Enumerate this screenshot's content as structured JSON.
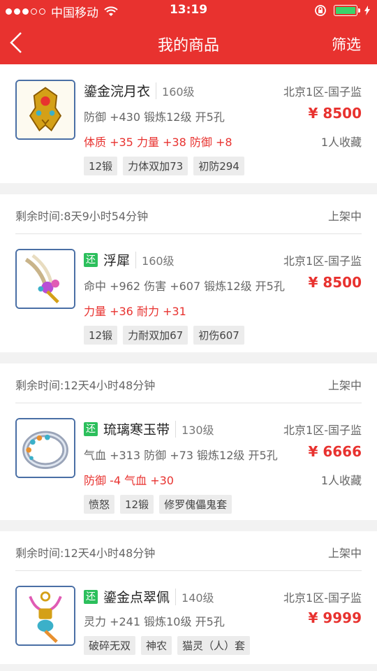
{
  "status_bar": {
    "carrier": "中国移动",
    "time": "13:19"
  },
  "nav": {
    "title": "我的商品",
    "filter_label": "筛选"
  },
  "items": [
    {
      "time_left": "",
      "status": "",
      "name": "鎏金浣月衣",
      "level": "160级",
      "server": "北京1区-国子监",
      "attrs": "防御 +430 锻炼12级 开5孔",
      "bonus": "体质 +35 力量 +38 防御 +8",
      "price": "¥ 8500",
      "favorites": "1人收藏",
      "tags": [
        "12锻",
        "力体双加73",
        "初防294"
      ],
      "returnable": false
    },
    {
      "time_left": "剩余时间:8天9小时54分钟",
      "status": "上架中",
      "name": "浮犀",
      "level": "160级",
      "server": "北京1区-国子监",
      "attrs": "命中 +962 伤害 +607 锻炼12级 开5孔",
      "bonus": "力量 +36 耐力 +31",
      "price": "¥ 8500",
      "favorites": "",
      "tags": [
        "12锻",
        "力耐双加67",
        "初伤607"
      ],
      "returnable": true,
      "return_label": "还"
    },
    {
      "time_left": "剩余时间:12天4小时48分钟",
      "status": "上架中",
      "name": "琉璃寒玉带",
      "level": "130级",
      "server": "北京1区-国子监",
      "attrs": "气血 +313 防御 +73 锻炼12级 开5孔",
      "bonus": "防御 -4 气血 +30",
      "price": "¥ 6666",
      "favorites": "1人收藏",
      "tags": [
        "愤怒",
        "12锻",
        "修罗傀儡鬼套"
      ],
      "returnable": true,
      "return_label": "还"
    },
    {
      "time_left": "剩余时间:12天4小时48分钟",
      "status": "上架中",
      "name": "鎏金点翠佩",
      "level": "140级",
      "server": "北京1区-国子监",
      "attrs": "灵力 +241 锻炼10级 开5孔",
      "bonus": "",
      "price": "¥ 9999",
      "favorites": "",
      "tags": [
        "破碎无双",
        "神农",
        "猫灵（人）套"
      ],
      "returnable": true,
      "return_label": "还"
    }
  ],
  "icons": {
    "back": "chevron-left-icon",
    "wifi": "wifi-icon",
    "lock": "orientation-lock-icon",
    "battery": "battery-icon",
    "charging": "charging-bolt-icon"
  },
  "colors": {
    "brand": "#e8322f",
    "return_badge": "#2cbf5c"
  }
}
